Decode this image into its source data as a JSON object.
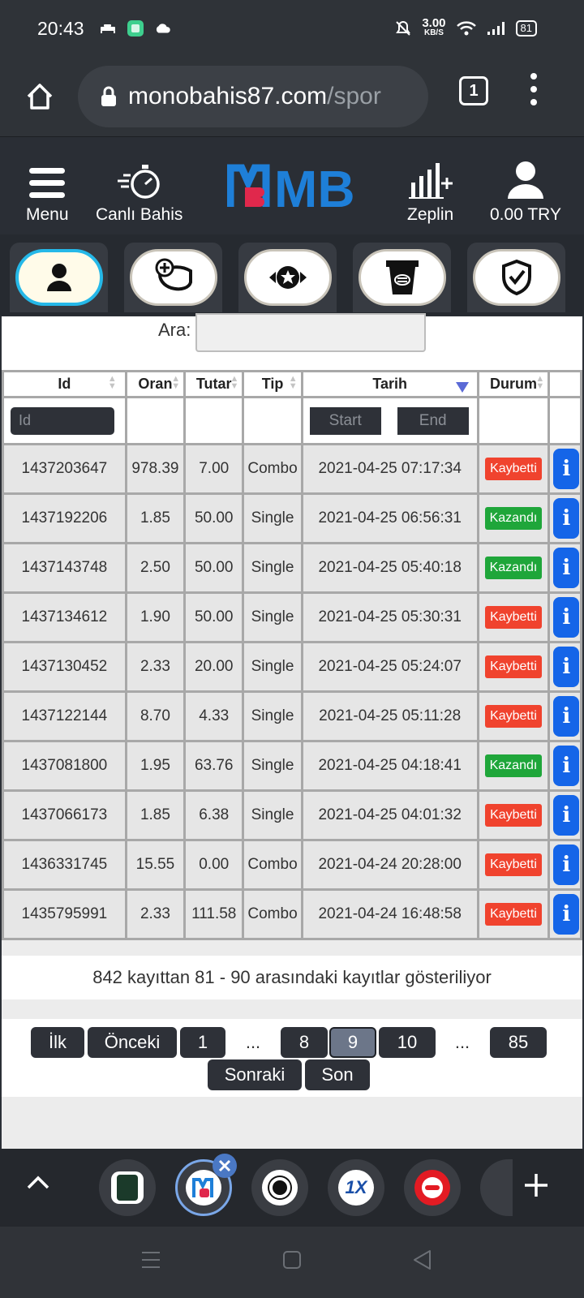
{
  "status_bar": {
    "time": "20:43",
    "net_speed_value": "3.00",
    "net_speed_unit": "KB/S",
    "battery": "81"
  },
  "browser": {
    "url_domain": "monobahis87.com",
    "url_path": "/spor",
    "tab_count": "1"
  },
  "site_header": {
    "menu_label": "Menu",
    "live_label": "Canlı Bahis",
    "zeplin_label": "Zeplin",
    "balance": "0.00 TRY",
    "logo_text": "MB"
  },
  "search": {
    "label": "Ara:"
  },
  "table": {
    "columns": [
      "Id",
      "Oran",
      "Tutar",
      "Tip",
      "Tarih",
      "Durum"
    ],
    "id_placeholder": "Id",
    "start_label": "Start",
    "end_label": "End",
    "info_label": "i",
    "rows": [
      {
        "id": "1437203647",
        "oran": "978.39",
        "tutar": "7.00",
        "tip": "Combo",
        "tarih": "2021-04-25 07:17:34",
        "durum": "Kaybetti"
      },
      {
        "id": "1437192206",
        "oran": "1.85",
        "tutar": "50.00",
        "tip": "Single",
        "tarih": "2021-04-25 06:56:31",
        "durum": "Kazandı"
      },
      {
        "id": "1437143748",
        "oran": "2.50",
        "tutar": "50.00",
        "tip": "Single",
        "tarih": "2021-04-25 05:40:18",
        "durum": "Kazandı"
      },
      {
        "id": "1437134612",
        "oran": "1.90",
        "tutar": "50.00",
        "tip": "Single",
        "tarih": "2021-04-25 05:30:31",
        "durum": "Kaybetti"
      },
      {
        "id": "1437130452",
        "oran": "2.33",
        "tutar": "20.00",
        "tip": "Single",
        "tarih": "2021-04-25 05:24:07",
        "durum": "Kaybetti"
      },
      {
        "id": "1437122144",
        "oran": "8.70",
        "tutar": "4.33",
        "tip": "Single",
        "tarih": "2021-04-25 05:11:28",
        "durum": "Kaybetti"
      },
      {
        "id": "1437081800",
        "oran": "1.95",
        "tutar": "63.76",
        "tip": "Single",
        "tarih": "2021-04-25 04:18:41",
        "durum": "Kazandı"
      },
      {
        "id": "1437066173",
        "oran": "1.85",
        "tutar": "6.38",
        "tip": "Single",
        "tarih": "2021-04-25 04:01:32",
        "durum": "Kaybetti"
      },
      {
        "id": "1436331745",
        "oran": "15.55",
        "tutar": "0.00",
        "tip": "Combo",
        "tarih": "2021-04-24 20:28:00",
        "durum": "Kaybetti"
      },
      {
        "id": "1435795991",
        "oran": "2.33",
        "tutar": "111.58",
        "tip": "Combo",
        "tarih": "2021-04-24 16:48:58",
        "durum": "Kaybetti"
      }
    ]
  },
  "status_colors": {
    "Kaybetti": "#f0432e",
    "Kazandı": "#1fa63a"
  },
  "summary": "842 kayıttan 81 - 90 arasındaki kayıtlar gösteriliyor",
  "pagination": {
    "first": "İlk",
    "prev": "Önceki",
    "p1": "1",
    "dots": "...",
    "p8": "8",
    "p9": "9",
    "p10": "10",
    "p85": "85",
    "next": "Sonraki",
    "last": "Son"
  },
  "tab_switcher": {
    "tab2_label": "1X"
  }
}
